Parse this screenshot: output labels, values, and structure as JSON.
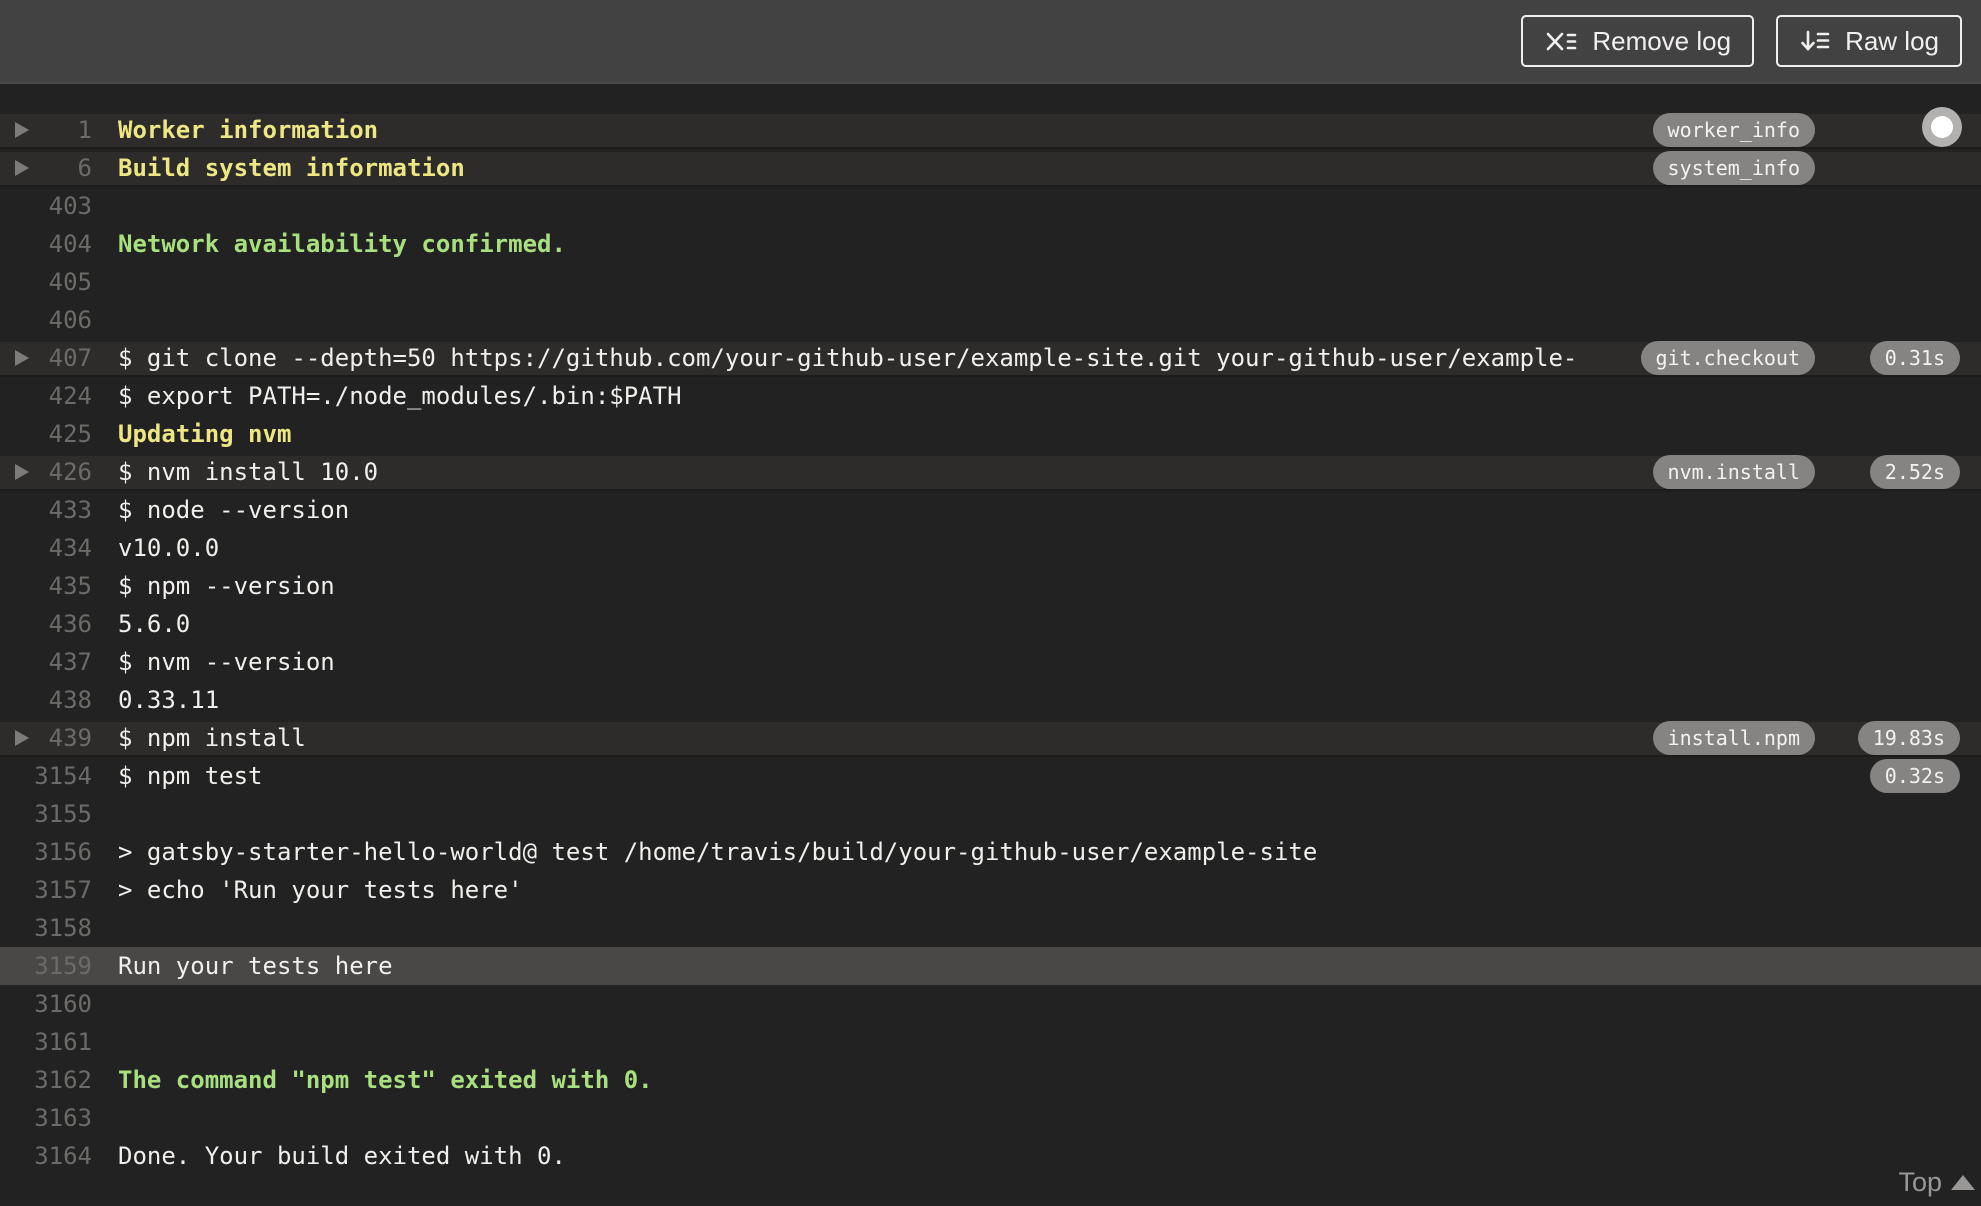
{
  "toolbar": {
    "remove_log_label": "Remove log",
    "raw_log_label": "Raw log"
  },
  "colors": {
    "topbar_bg": "#434242",
    "log_bg": "#232222",
    "fold_row_bg": "#2d2c2b",
    "highlight_row_bg": "#4a4846",
    "text": "#f1efeb",
    "line_number": "#6d6b68",
    "warn": "#ece683",
    "success": "#a8e07f",
    "pill_bg": "#858483"
  },
  "log": {
    "top_link_label": "Top",
    "rows": [
      {
        "line": "1",
        "text": "Worker information",
        "style": "warn",
        "fold": true,
        "tag": "worker_info"
      },
      {
        "line": "6",
        "text": "Build system information",
        "style": "warn",
        "fold": true,
        "tag": "system_info"
      },
      {
        "line": "403",
        "text": ""
      },
      {
        "line": "404",
        "text": "Network availability confirmed.",
        "style": "success"
      },
      {
        "line": "405",
        "text": ""
      },
      {
        "line": "406",
        "text": ""
      },
      {
        "line": "407",
        "text": "$ git clone --depth=50 https://github.com/your-github-user/example-site.git your-github-user/example-",
        "fold": true,
        "tag": "git.checkout",
        "time": "0.31s"
      },
      {
        "line": "424",
        "text": "$ export PATH=./node_modules/.bin:$PATH"
      },
      {
        "line": "425",
        "text": "Updating nvm",
        "style": "warn"
      },
      {
        "line": "426",
        "text": "$ nvm install 10.0",
        "fold": true,
        "tag": "nvm.install",
        "time": "2.52s"
      },
      {
        "line": "433",
        "text": "$ node --version"
      },
      {
        "line": "434",
        "text": "v10.0.0"
      },
      {
        "line": "435",
        "text": "$ npm --version"
      },
      {
        "line": "436",
        "text": "5.6.0"
      },
      {
        "line": "437",
        "text": "$ nvm --version"
      },
      {
        "line": "438",
        "text": "0.33.11"
      },
      {
        "line": "439",
        "text": "$ npm install",
        "fold": true,
        "tag": "install.npm",
        "time": "19.83s"
      },
      {
        "line": "3154",
        "text": "$ npm test",
        "time": "0.32s"
      },
      {
        "line": "3155",
        "text": ""
      },
      {
        "line": "3156",
        "text": "> gatsby-starter-hello-world@ test /home/travis/build/your-github-user/example-site"
      },
      {
        "line": "3157",
        "text": "> echo 'Run your tests here'"
      },
      {
        "line": "3158",
        "text": ""
      },
      {
        "line": "3159",
        "text": "Run your tests here",
        "highlight": true
      },
      {
        "line": "3160",
        "text": ""
      },
      {
        "line": "3161",
        "text": ""
      },
      {
        "line": "3162",
        "text": "The command \"npm test\" exited with 0.",
        "style": "success"
      },
      {
        "line": "3163",
        "text": ""
      },
      {
        "line": "3164",
        "text": "Done. Your build exited with 0."
      }
    ]
  }
}
